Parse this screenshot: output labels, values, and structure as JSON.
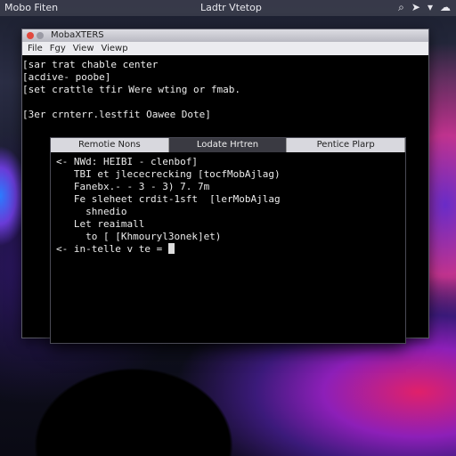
{
  "menubar": {
    "app_name": "Mobo Fiten",
    "center_title": "Ladtr Vtetop",
    "icons": [
      "search-icon",
      "location-icon",
      "wifi-icon",
      "cloud-icon"
    ]
  },
  "back_window": {
    "title": "MobaXTERS",
    "menu": [
      "File",
      "Fgy",
      "View",
      "Viewp"
    ],
    "lines": [
      "[sar trat chable center",
      "[acdive- poobe]",
      "[set crattle tfir Were wting or fmab.",
      "",
      "[3er crnterr.lestfit Oawee Dote]"
    ]
  },
  "front_window": {
    "tabs": [
      "Remotie Nons",
      "Lodate Hrtren",
      "Pentice Plarp"
    ],
    "active_tab": 1,
    "lines": [
      "<- NWd: HEIBI - clenbof]",
      "   TBI et jlececrecking [tocfMobAjlag)",
      "   Fanebx.- - 3 - 3) 7. 7m",
      "   Fe sleheet crdit-1sft  [lerMobAjlag",
      "     shnedio",
      "   Let reaimall",
      "     to [ [Khmouryl3onek]et)",
      "<- in-telle v te = "
    ]
  }
}
